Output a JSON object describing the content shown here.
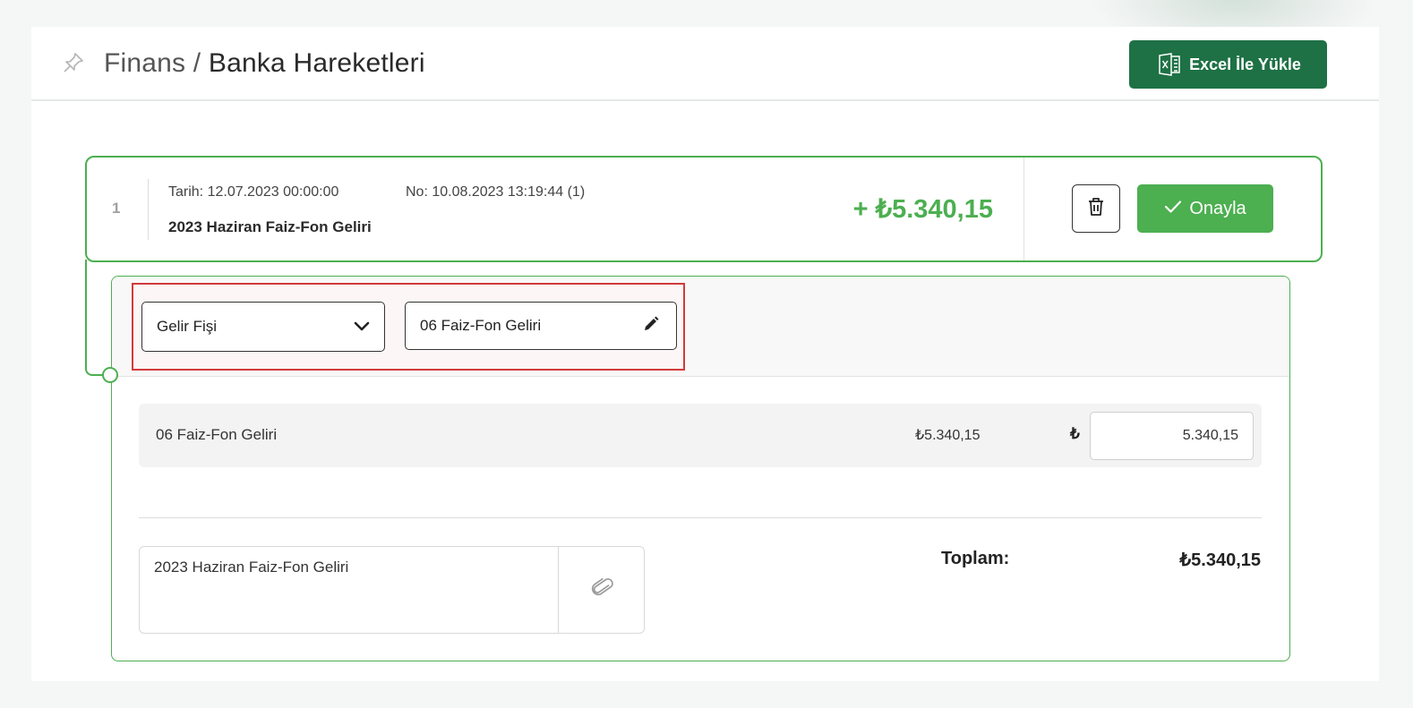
{
  "breadcrumb": {
    "parent": "Finans",
    "separator": " / ",
    "current": "Banka Hareketleri"
  },
  "header": {
    "excel_button_label": "Excel İle Yükle",
    "excel_icon": "excel-file-icon",
    "pin_icon": "pin-icon"
  },
  "transaction": {
    "index": "1",
    "date": "Tarih: 12.07.2023 00:00:00",
    "number": "No: 10.08.2023 13:19:44 (1)",
    "description": "2023 Haziran Faiz-Fon Geliri",
    "amount": "+ ₺5.340,15",
    "delete_icon": "trash-icon",
    "approve_label": "Onayla",
    "approve_icon": "check-icon"
  },
  "detail": {
    "document_type": "Gelir Fişi",
    "account": "06 Faiz-Fon Geliri",
    "line": {
      "name": "06 Faiz-Fon Geliri",
      "amount": "₺5.340,15",
      "currency_symbol": "₺",
      "input_value": "5.340,15"
    },
    "note": "2023 Haziran Faiz-Fon Geliri",
    "total_label": "Toplam:",
    "total_value": "₺5.340,15"
  },
  "colors": {
    "accent_green": "#4caf50",
    "excel_green": "#1e7145",
    "highlight_red": "#d23a3a"
  }
}
